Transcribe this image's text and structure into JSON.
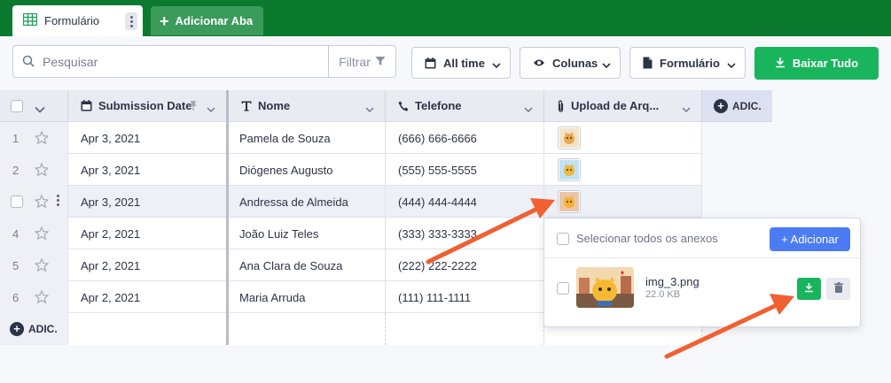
{
  "tabs": [
    {
      "label": "Formulário",
      "active": true
    },
    {
      "label": "Adicionar Aba",
      "active": false
    }
  ],
  "toolbar": {
    "search_placeholder": "Pesquisar",
    "filter_label": "Filtrar",
    "time_filter": "All time",
    "columns_label": "Colunas",
    "form_label": "Formulário",
    "download_all_label": "Baixar Tudo"
  },
  "columns": [
    {
      "label": "Submission Date",
      "icon": "calendar-icon"
    },
    {
      "label": "Nome",
      "icon": "text-icon"
    },
    {
      "label": "Telefone",
      "icon": "phone-icon"
    },
    {
      "label": "Upload de Arq...",
      "icon": "paperclip-icon"
    }
  ],
  "add_column_label": "ADIC.",
  "rows": [
    {
      "num": "1",
      "date": "Apr 3, 2021",
      "name": "Pamela de Souza",
      "phone": "(666) 666-6666"
    },
    {
      "num": "2",
      "date": "Apr 3, 2021",
      "name": "Diógenes Augusto",
      "phone": "(555) 555-5555"
    },
    {
      "num": "",
      "date": "Apr 3, 2021",
      "name": "Andressa de Almeida",
      "phone": "(444) 444-4444"
    },
    {
      "num": "4",
      "date": "Apr 2, 2021",
      "name": "João Luiz Teles",
      "phone": "(333) 333-3333"
    },
    {
      "num": "5",
      "date": "Apr 2, 2021",
      "name": "Ana Clara de Souza",
      "phone": "(222) 222-2222"
    },
    {
      "num": "6",
      "date": "Apr 2, 2021",
      "name": "Maria Arruda",
      "phone": "(111) 111-1111"
    }
  ],
  "add_row_label": "ADIC.",
  "attachment_popup": {
    "select_all_label": "Selecionar todos os anexos",
    "add_button_label": "+ Adicionar",
    "file_name": "img_3.png",
    "file_size": "22.0 KB"
  },
  "colors": {
    "tabbar": "#0b7a2e",
    "primary_green": "#18b55d",
    "blue": "#4b7cf3",
    "arrow": "#f06030"
  }
}
